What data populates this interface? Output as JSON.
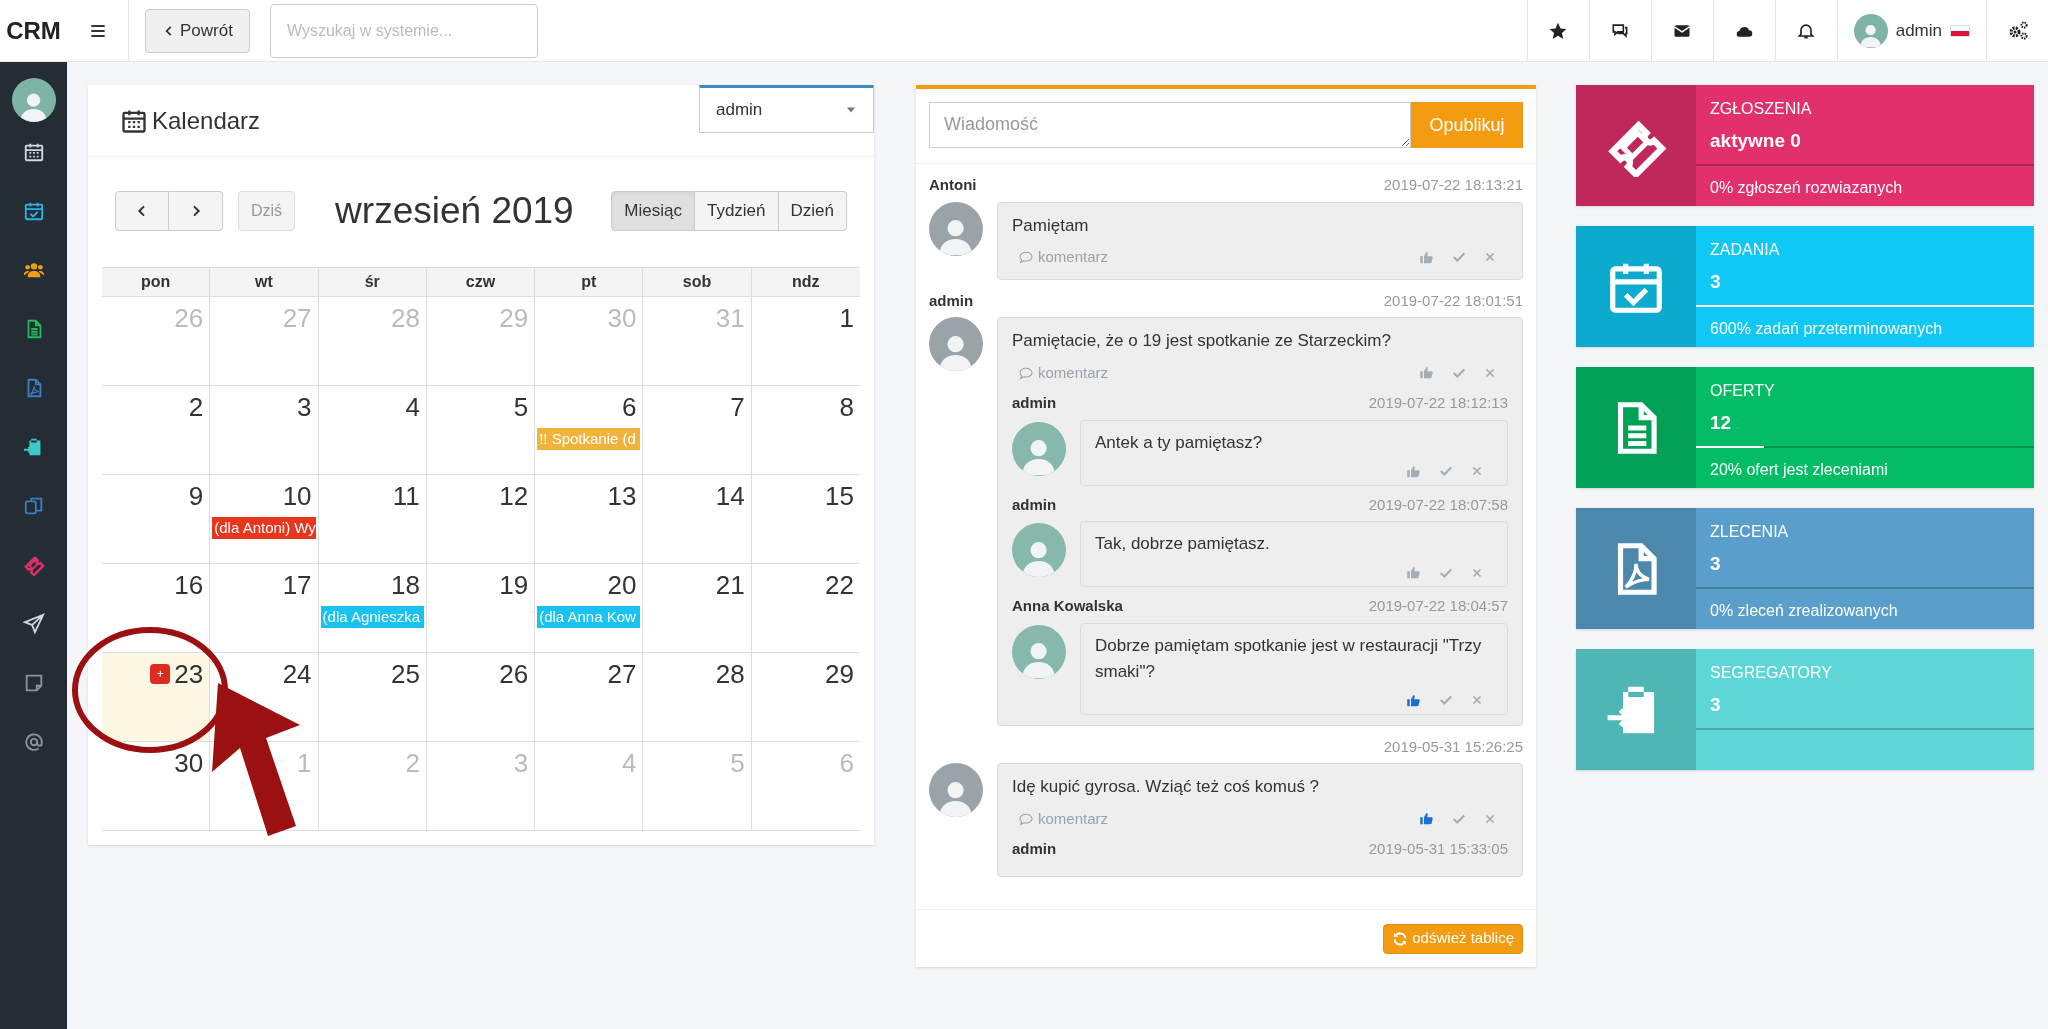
{
  "topbar": {
    "logo": "CRM",
    "back_button": "Powrót",
    "search": {
      "placeholder": "Wyszukaj w systemie..."
    },
    "user": "admin"
  },
  "calendar": {
    "title": "Kalendarz",
    "user_select": "admin",
    "today_button": "Dziś",
    "month_title": "wrzesień 2019",
    "views": [
      {
        "label": "Miesiąc",
        "selected": true
      },
      {
        "label": "Tydzień",
        "selected": false
      },
      {
        "label": "Dzień",
        "selected": false
      }
    ],
    "weekdays": [
      "pon",
      "wt",
      "śr",
      "czw",
      "pt",
      "sob",
      "ndz"
    ],
    "weeks": [
      [
        {
          "day": "26",
          "other_month": true
        },
        {
          "day": "27",
          "other_month": true
        },
        {
          "day": "28",
          "other_month": true
        },
        {
          "day": "29",
          "other_month": true
        },
        {
          "day": "30",
          "other_month": true
        },
        {
          "day": "31",
          "other_month": true
        },
        {
          "day": "1",
          "other_month": false
        }
      ],
      [
        {
          "day": "2",
          "other_month": false
        },
        {
          "day": "3",
          "other_month": false
        },
        {
          "day": "4",
          "other_month": false
        },
        {
          "day": "5",
          "other_month": false
        },
        {
          "day": "6",
          "other_month": false,
          "events": [
            {
              "title": "!! Spotkanie (d",
              "color": "#f0b43c"
            }
          ]
        },
        {
          "day": "7",
          "other_month": false
        },
        {
          "day": "8",
          "other_month": false
        }
      ],
      [
        {
          "day": "9",
          "other_month": false
        },
        {
          "day": "10",
          "other_month": false,
          "events": [
            {
              "title": "(dla Antoni) Wy",
              "color": "#e8351e"
            }
          ]
        },
        {
          "day": "11",
          "other_month": false
        },
        {
          "day": "12",
          "other_month": false
        },
        {
          "day": "13",
          "other_month": false
        },
        {
          "day": "14",
          "other_month": false
        },
        {
          "day": "15",
          "other_month": false
        }
      ],
      [
        {
          "day": "16",
          "other_month": false
        },
        {
          "day": "17",
          "other_month": false
        },
        {
          "day": "18",
          "other_month": false,
          "events": [
            {
              "title": "(dla Agnieszka",
              "color": "#18c3f0"
            }
          ]
        },
        {
          "day": "19",
          "other_month": false
        },
        {
          "day": "20",
          "other_month": false,
          "events": [
            {
              "title": "(dla Anna Kow",
              "color": "#18c3f0"
            }
          ]
        },
        {
          "day": "21",
          "other_month": false
        },
        {
          "day": "22",
          "other_month": false
        }
      ],
      [
        {
          "day": "23",
          "other_month": false,
          "today": true,
          "add_button": "+"
        },
        {
          "day": "24",
          "other_month": false
        },
        {
          "day": "25",
          "other_month": false
        },
        {
          "day": "26",
          "other_month": false
        },
        {
          "day": "27",
          "other_month": false
        },
        {
          "day": "28",
          "other_month": false
        },
        {
          "day": "29",
          "other_month": false
        }
      ],
      [
        {
          "day": "30",
          "other_month": false
        },
        {
          "day": "1",
          "other_month": true
        },
        {
          "day": "2",
          "other_month": true
        },
        {
          "day": "3",
          "other_month": true
        },
        {
          "day": "4",
          "other_month": true
        },
        {
          "day": "5",
          "other_month": true
        },
        {
          "day": "6",
          "other_month": true
        }
      ]
    ]
  },
  "feed": {
    "message_placeholder": "Wiadomość",
    "publish_button": "Opublikuj",
    "posts": [
      {
        "author": "Antoni",
        "time": "2019-07-22 18:13:21",
        "text": "Pamiętam",
        "comment_link": "komentarz",
        "liked": false
      },
      {
        "author": "admin",
        "time": "2019-07-22 18:01:51",
        "text": "Pamiętacie, że o 19 jest spotkanie ze Starzeckim?",
        "comment_link": "komentarz",
        "liked": false,
        "replies": [
          {
            "author": "admin",
            "time": "2019-07-22 18:12:13",
            "text": "Antek a ty pamiętasz?",
            "liked": false
          },
          {
            "author": "admin",
            "time": "2019-07-22 18:07:58",
            "text": "Tak, dobrze pamiętasz.",
            "liked": false
          },
          {
            "author": "Anna Kowalska",
            "time": "2019-07-22 18:04:57",
            "text": "Dobrze pamiętam spotkanie jest w restauracji \"Trzy smaki\"?",
            "liked": true
          }
        ]
      },
      {
        "time": "2019-05-31 15:26:25",
        "text": "Idę kupić gyrosa. Wziąć też coś komuś ?",
        "comment_link": "komentarz",
        "liked": true,
        "replies": [
          {
            "author": "admin",
            "time": "2019-05-31 15:33:05"
          }
        ]
      }
    ],
    "refresh_button": "odśwież tablicę"
  },
  "stats": [
    {
      "title": "ZGŁOSZENIA",
      "value": "aktywne 0",
      "level": 0,
      "footer": "0% zgłoszeń rozwiazanych",
      "color": "#e1306c"
    },
    {
      "title": "ZADANIA",
      "value": "3",
      "level": 1,
      "footer": "600% zadań przeterminowanych",
      "color": "#10c8f5"
    },
    {
      "title": "OFERTY",
      "value": "12",
      "level": 0.2,
      "footer": "20% ofert jest zleceniami",
      "color": "#03bd66"
    },
    {
      "title": "ZLECENIA",
      "value": "3",
      "level": 0,
      "footer": "0% zleceń zrealizowanych",
      "color": "#5a9fcc"
    },
    {
      "title": "SEGREGATORY",
      "value": "3",
      "level": 0,
      "color": "#5dd6d6"
    }
  ]
}
